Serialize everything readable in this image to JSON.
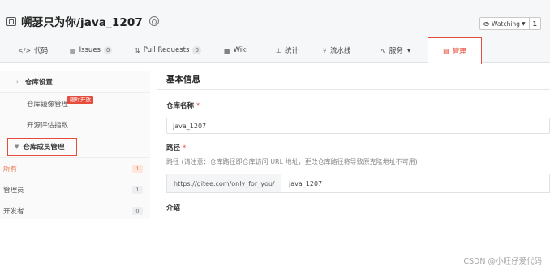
{
  "repo": {
    "title": "嗍瑟只为你/java_1207",
    "watch_label": "Watching",
    "watch_count": "1"
  },
  "tabs": [
    {
      "label": "代码",
      "icon": "code-icon",
      "badge": ""
    },
    {
      "label": "Issues",
      "icon": "issues-icon",
      "badge": "0"
    },
    {
      "label": "Pull Requests",
      "icon": "pull-request-icon",
      "badge": "0"
    },
    {
      "label": "Wiki",
      "icon": "wiki-icon",
      "badge": ""
    },
    {
      "label": "统计",
      "icon": "chart-icon",
      "badge": ""
    },
    {
      "label": "流水线",
      "icon": "pipeline-icon",
      "badge": ""
    },
    {
      "label": "服务",
      "icon": "service-icon",
      "badge": ""
    },
    {
      "label": "管理",
      "icon": "manage-icon",
      "badge": "",
      "active": true
    }
  ],
  "sidebar": {
    "settings": "仓库设置",
    "mirror": "仓库镜像管理",
    "mirror_flag": "限时开放",
    "evaluate": "开源评估指数",
    "members": "仓库成员管理",
    "member_items": [
      {
        "label": "所有",
        "count": "1"
      },
      {
        "label": "管理员",
        "count": "1"
      },
      {
        "label": "开发者",
        "count": "0"
      }
    ]
  },
  "main": {
    "section_title": "基本信息",
    "name_label": "仓库名称",
    "name_value": "java_1207",
    "path_label": "路径",
    "path_hint": "路径 (请注意：仓库路径即仓库访问 URL 地址，更改仓库路径将导致原克隆地址不可用)",
    "path_prefix": "https://gitee.com/only_for_you/",
    "path_value": "java_1207",
    "intro_label": "介绍",
    "required_mark": "*"
  },
  "footer": {
    "watermark": "CSDN @小旺仔爱代码"
  },
  "colors": {
    "accent": "#e64c3c",
    "member_active": "#e8744a",
    "header_bg": "#f6f7f8"
  }
}
